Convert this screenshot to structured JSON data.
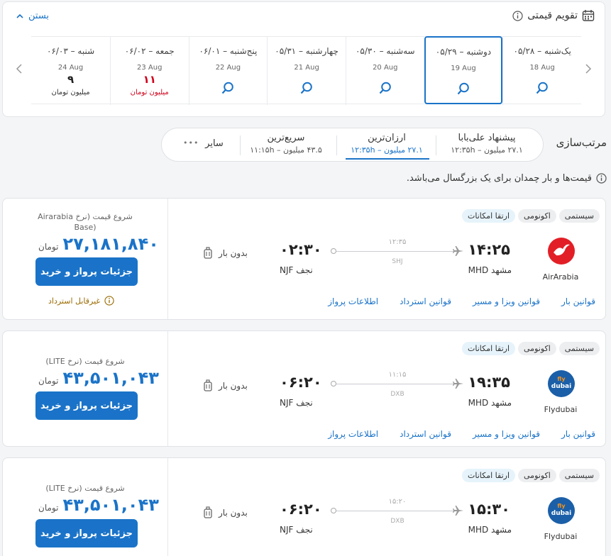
{
  "calendar": {
    "title": "تقویم قیمتی",
    "close_label": "بستن",
    "days": [
      {
        "name": "یک‌شنبه – ۰۵/۲۸",
        "date": "18 Aug"
      },
      {
        "name": "دوشنبه – ۰۵/۲۹",
        "date": "19 Aug",
        "selected": true
      },
      {
        "name": "سه‌شنبه – ۰۵/۳۰",
        "date": "20 Aug"
      },
      {
        "name": "چهارشنبه – ۰۵/۳۱",
        "date": "21 Aug"
      },
      {
        "name": "پنج‌شنبه – ۰۶/۰۱",
        "date": "22 Aug"
      },
      {
        "name": "جمعه – ۰۶/۰۲",
        "date": "23 Aug",
        "price": "۱۱",
        "unit": "میلیون تومان",
        "color": "#d0021b"
      },
      {
        "name": "شنبه – ۰۶/۰۳",
        "date": "24 Aug",
        "price": "۹",
        "unit": "میلیون تومان"
      }
    ]
  },
  "sort": {
    "label": "مرتب‌سازی",
    "options": [
      {
        "title": "پیشنهاد علی‌بابا",
        "sub": "۲۷.۱ میلیون – ۱۲:۳۵h"
      },
      {
        "title": "ارزان‌ترین",
        "sub": "۲۷.۱ میلیون – ۱۲:۳۵h",
        "active": true
      },
      {
        "title": "سریع‌ترین",
        "sub": "۴۳.۵ میلیون – ۱۱:۱۵h"
      },
      {
        "title": "سایر"
      }
    ],
    "more": "•••"
  },
  "info": "قیمت‌ها و بار چمدان برای یک بزرگسال می‌باشد.",
  "flights": [
    {
      "tags": [
        "سیستمی",
        "اکونومی",
        "ارتقا امکانات"
      ],
      "airline": "AirArabia",
      "logo_color": "#e21f26",
      "logo_text": "",
      "dep_time": "۱۴:۲۵",
      "dep_city": "مشهد MHD",
      "arr_time": "۰۲:۳۰",
      "arr_city": "نجف NJF",
      "duration": "۱۲:۳۵",
      "stop": "SHJ",
      "baggage": "بدون بار",
      "links": [
        "اطلاعات پرواز",
        "قوانین استرداد",
        "قوانین ویزا و مسیر",
        "قوانین بار"
      ],
      "price_label": "شروع قیمت (نرخ Airarabia Base)",
      "price_label_1": "شروع قیمت (نرخ Airarabia",
      "price_label_2": "(Base",
      "price": "۲۷,۱۸۱,۸۴۰",
      "currency": "تومان",
      "button": "جزئیات پرواز و خرید",
      "refund": "غیرقابل استرداد"
    },
    {
      "tags": [
        "سیستمی",
        "اکونومی",
        "ارتقا امکانات"
      ],
      "airline": "Flydubai",
      "logo_color": "#1b5fa8",
      "logo_text": "dubai",
      "dep_time": "۱۹:۳۵",
      "dep_city": "مشهد MHD",
      "arr_time": "۰۶:۲۰",
      "arr_city": "نجف NJF",
      "duration": "۱۱:۱۵",
      "stop": "DXB",
      "baggage": "بدون بار",
      "links": [
        "اطلاعات پرواز",
        "قوانین استرداد",
        "قوانین ویزا و مسیر",
        "قوانین بار"
      ],
      "price_label": "شروع قیمت (نرخ LITE)",
      "price": "۴۳,۵۰۱,۰۴۳",
      "currency": "تومان",
      "button": "جزئیات پرواز و خرید"
    },
    {
      "tags": [
        "سیستمی",
        "اکونومی",
        "ارتقا امکانات"
      ],
      "airline": "Flydubai",
      "logo_color": "#1b5fa8",
      "logo_text": "dubai",
      "dep_time": "۱۵:۳۰",
      "dep_city": "مشهد MHD",
      "arr_time": "۰۶:۲۰",
      "arr_city": "نجف NJF",
      "duration": "۱۵:۲۰",
      "stop": "DXB",
      "baggage": "بدون بار",
      "price_label": "شروع قیمت (نرخ LITE)",
      "price": "۴۳,۵۰۱,۰۴۳",
      "currency": "تومان",
      "button": "جزئیات پرواز و خرید"
    }
  ],
  "colors": {
    "accent": "#1a73c8",
    "warning": "#9a6a00",
    "price_high": "#d0021b"
  }
}
